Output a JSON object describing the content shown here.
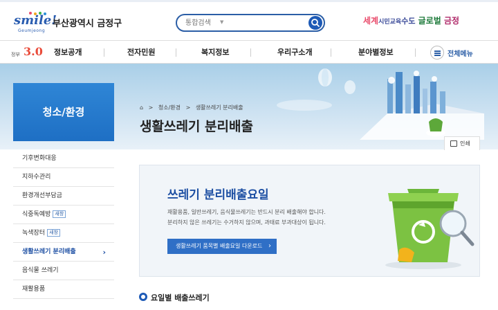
{
  "header": {
    "logo_script": "smile!",
    "logo_sub": "Geumjeong",
    "logo_text": "부산광역시 금정구",
    "search_placeholder": "통합검색",
    "slogan_1": "세계",
    "slogan_2": "시민교육",
    "slogan_3": "수도",
    "slogan_4": "글로벌",
    "slogan_5": "금정",
    "accent": "#1d5ab6"
  },
  "nav": {
    "badge_prefix": "정부",
    "badge_number": "3.0",
    "items": [
      "정보공개",
      "전자민원",
      "복지정보",
      "우리구소개",
      "분야별정보"
    ],
    "all_menu": "전체메뉴"
  },
  "sidebar": {
    "heading": "청소/환경",
    "items": [
      {
        "label": "기후변화대응",
        "tag": ""
      },
      {
        "label": "지하수관리",
        "tag": ""
      },
      {
        "label": "환경개선부담금",
        "tag": ""
      },
      {
        "label": "식중독예방",
        "tag": "새창"
      },
      {
        "label": "녹색장터",
        "tag": "새창"
      },
      {
        "label": "생활쓰레기 분리배출",
        "tag": ""
      },
      {
        "label": "음식물 쓰레기",
        "tag": ""
      },
      {
        "label": "재활용품",
        "tag": ""
      }
    ]
  },
  "breadcrumb": {
    "items": [
      "청소/환경",
      "생활쓰레기 분리배출"
    ],
    "sep": ">"
  },
  "page": {
    "title": "생활쓰레기 분리배출",
    "print_label": "인쇄"
  },
  "content": {
    "box_title": "쓰레기 분리배출요일",
    "desc_1": "재활용품, 일반쓰레기, 음식물쓰레기는 반드시 분리 배출해야 합니다.",
    "desc_2": "분리하지 않은 쓰레기는 수거하지 않으며, 과태료 부과대상이 됩니다.",
    "download_button": "생활쓰레기 품목별 배출요일 다운로드",
    "section_heading": "요일별 배출쓰레기"
  }
}
